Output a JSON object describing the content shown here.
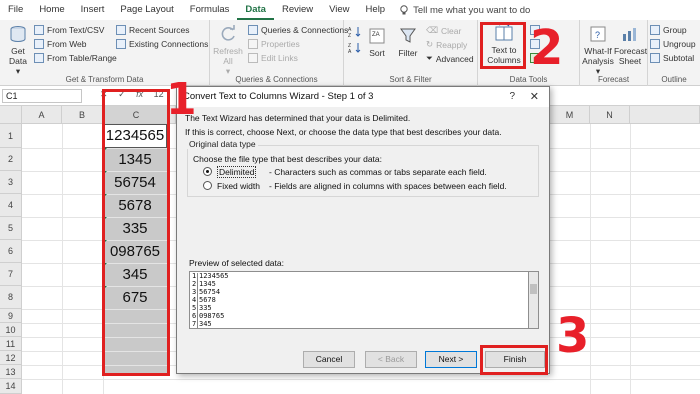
{
  "menu": {
    "tabs": [
      "File",
      "Home",
      "Insert",
      "Page Layout",
      "Formulas",
      "Data",
      "Review",
      "View",
      "Help"
    ],
    "active": "Data",
    "tell_me": "Tell me what you want to do"
  },
  "ribbon": {
    "get_data": "Get Data",
    "get_data_arrow": "▾",
    "from_text_csv": "From Text/CSV",
    "from_web": "From Web",
    "from_table_range": "From Table/Range",
    "recent_sources": "Recent Sources",
    "existing_connections": "Existing Connections",
    "group_get_transform": "Get & Transform Data",
    "refresh_all": "Refresh All",
    "refresh_all_arrow": "▾",
    "queries_connections": "Queries & Connections",
    "properties": "Properties",
    "edit_links": "Edit Links",
    "group_queries": "Queries & Connections",
    "sort": "Sort",
    "filter": "Filter",
    "clear": "Clear",
    "reapply": "Reapply",
    "advanced": "Advanced",
    "group_sort_filter": "Sort & Filter",
    "text_to_columns": "Text to Columns",
    "group_data_tools": "Data Tools",
    "what_if": "What-If Analysis",
    "what_if_arrow": "▾",
    "forecast_sheet": "Forecast Sheet",
    "group_forecast": "Forecast",
    "group_btn": "Group",
    "ungroup_btn": "Ungroup",
    "subtotal": "Subtotal",
    "group_outline": "Outline"
  },
  "annotations": {
    "num1": "1",
    "num2": "2",
    "num3": "3"
  },
  "formula_bar": {
    "name_box": "C1",
    "cancel": "✕",
    "enter": "✓",
    "fx": "fx",
    "value": "12"
  },
  "sheet": {
    "columns": [
      "A",
      "B",
      "C"
    ],
    "column_d_partial": "D",
    "column_m": "M",
    "column_n": "N",
    "rows": [
      "1",
      "2",
      "3",
      "4",
      "5",
      "6",
      "7",
      "8",
      "9",
      "10",
      "11",
      "12",
      "13",
      "14"
    ],
    "column_c_values": [
      "1234565",
      "1345",
      "56754",
      "5678",
      "335",
      "098765",
      "345",
      "675"
    ]
  },
  "dialog": {
    "title": "Convert Text to Columns Wizard - Step 1 of 3",
    "help": "?",
    "close": "✕",
    "intro": "The Text Wizard has determined that your data is Delimited.",
    "intro2": "If this is correct, choose Next, or choose the data type that best describes your data.",
    "original_data_type": "Original data type",
    "choose_file_type": "Choose the file type that best describes your data:",
    "delimited_label": "Delimited",
    "delimited_desc": "- Characters such as commas or tabs separate each field.",
    "fixed_width_label": "Fixed width",
    "fixed_width_desc": "- Fields are aligned in columns with spaces between each field.",
    "preview_label": "Preview of selected data:",
    "preview_rows": [
      "1234565",
      "1345",
      "56754",
      "5678",
      "335",
      "098765",
      "345"
    ],
    "cancel": "Cancel",
    "back": "< Back",
    "next": "Next >",
    "finish": "Finish"
  },
  "colors": {
    "accent": "#217346",
    "annotation_red": "#e02020"
  }
}
